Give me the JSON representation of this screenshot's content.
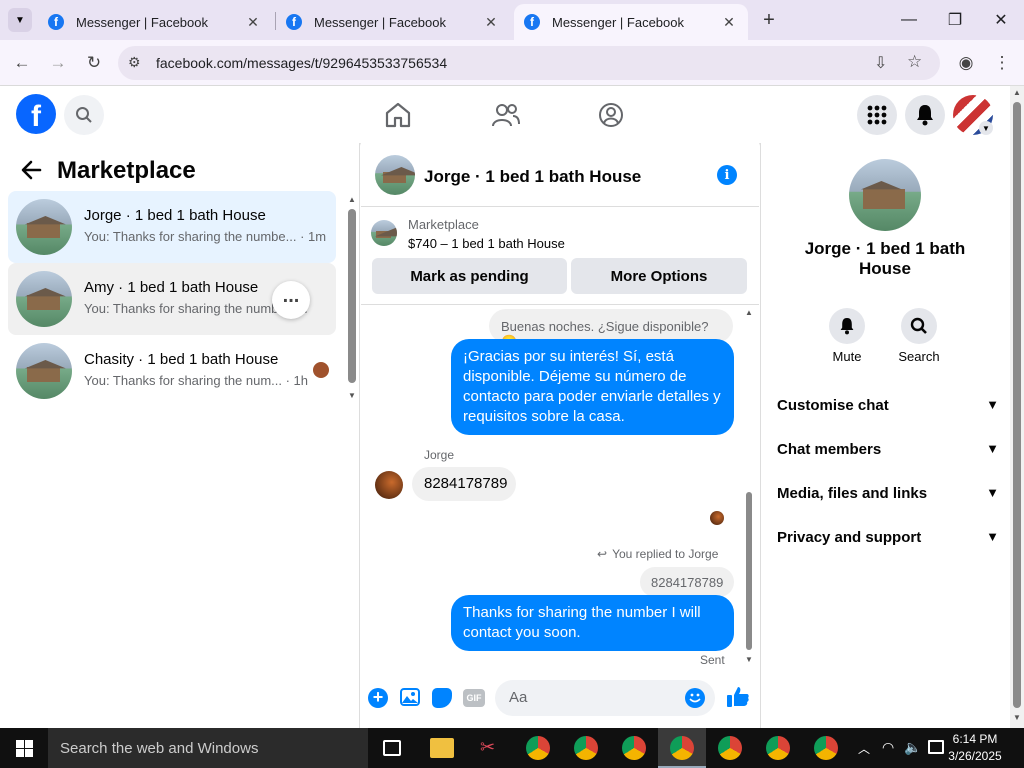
{
  "browser": {
    "tabs": [
      {
        "title": "Messenger | Facebook"
      },
      {
        "title": "Messenger | Facebook"
      },
      {
        "title": "Messenger | Facebook"
      }
    ],
    "url": "facebook.com/messages/t/9296453533756534"
  },
  "left_panel": {
    "title": "Marketplace",
    "conversations": [
      {
        "name": "Jorge · 1 bed 1 bath House",
        "snippet": "You: Thanks for sharing the numbe... · 1m"
      },
      {
        "name": "Amy · 1 bed 1 bath House",
        "snippet": "You: Thanks for sharing the numb... 1h"
      },
      {
        "name": "Chasity · 1 bed 1 bath House",
        "snippet": "You: Thanks for sharing the num... · 1h"
      }
    ],
    "more_icon": "ellipsis-icon"
  },
  "chat": {
    "header_title": "Jorge · 1 bed 1 bath House",
    "listing_source": "Marketplace",
    "listing_price": "$740 – 1 bed 1 bath House",
    "mark_pending_label": "Mark as pending",
    "more_options_label": "More Options",
    "messages": {
      "quoted_top": "Buenas noches. ¿Sigue disponible? 😊",
      "reply_es": "¡Gracias por su interés! Sí, está disponible. Déjeme su número de contacto para poder enviarle detalles y requisitos sobre la casa.",
      "sender_name": "Jorge",
      "incoming_number": "8284178789",
      "replied_label": "You replied to Jorge",
      "quoted_number": "8284178789",
      "reply_en": "Thanks for sharing the number I will contact you soon.",
      "status": "Sent"
    },
    "composer_placeholder": "Aa"
  },
  "right_panel": {
    "name": "Jorge · 1 bed 1 bath House",
    "mute_label": "Mute",
    "search_label": "Search",
    "sections": [
      "Customise chat",
      "Chat members",
      "Media, files and links",
      "Privacy and support"
    ]
  },
  "taskbar": {
    "search_placeholder": "Search the web and Windows",
    "time": "6:14 PM",
    "date": "3/26/2025"
  },
  "colors": {
    "fb_blue": "#0866ff",
    "messenger_blue": "#0084ff",
    "selected_row": "#e7f3ff",
    "hover_row": "#f0f0f0"
  }
}
